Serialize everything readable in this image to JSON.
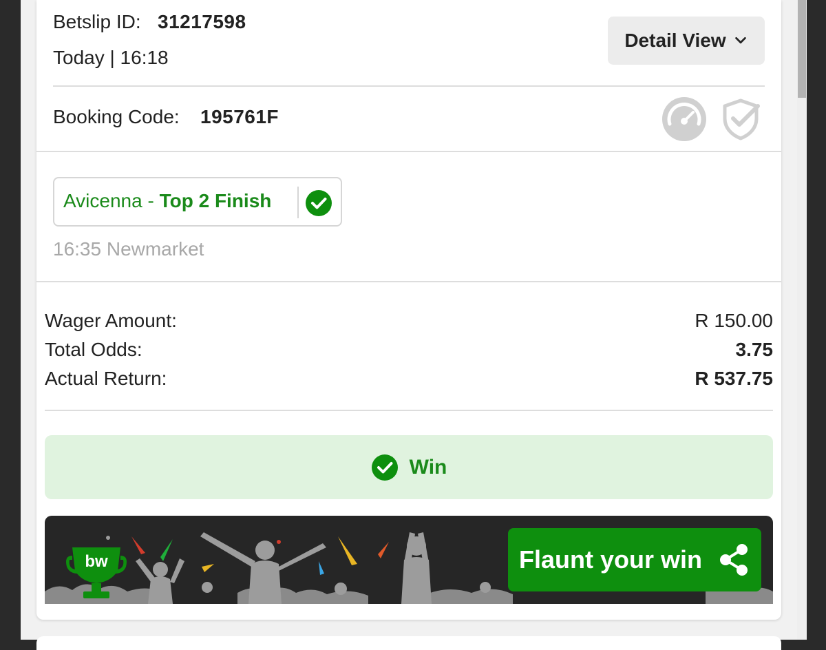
{
  "betslip": {
    "id_label": "Betslip ID:",
    "id_value": "31217598",
    "datetime": "Today | 16:18",
    "detail_view_label": "Detail View",
    "booking_label": "Booking Code:",
    "booking_code": "195761F"
  },
  "selection": {
    "runner": "Avicenna",
    "separator": " - ",
    "market": "Top 2 Finish",
    "event": "16:35 Newmarket",
    "status_icon": "check-circle-icon"
  },
  "summary": {
    "wager_label": "Wager Amount:",
    "wager_value": "R 150.00",
    "odds_label": "Total Odds:",
    "odds_value": "3.75",
    "return_label": "Actual Return:",
    "return_value": "R 537.75"
  },
  "result": {
    "label": "Win",
    "icon": "check-circle-icon"
  },
  "promo": {
    "logo_text": "bw",
    "button_label": "Flaunt your win",
    "button_icon": "share-icon"
  },
  "colors": {
    "brand_green": "#0e8f0e",
    "win_bg": "#e0f3df",
    "text_green": "#1a8a1a"
  }
}
